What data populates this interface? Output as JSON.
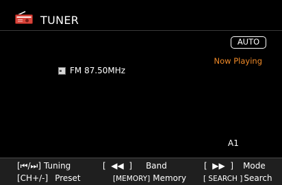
{
  "header": {
    "title": "TUNER",
    "icon": "radio-icon",
    "icon_color": "#d9443b"
  },
  "main": {
    "mode_badge": "AUTO",
    "now_playing": "Now Playing",
    "now_playing_color": "#f08a28",
    "band_icon": "fm-band-icon",
    "station": "FM 87.50MHz",
    "preset_number": "A1"
  },
  "footer": {
    "row1": [
      {
        "key": "[⏮/⏭]",
        "label": "Tuning"
      },
      {
        "key": "[  ◀◀  ]",
        "label": "Band"
      },
      {
        "key": "[  ▶▶  ]",
        "label": "Mode"
      }
    ],
    "row2": [
      {
        "key": "[CH+/-]",
        "label": "Preset"
      },
      {
        "key": "[MEMORY]",
        "label": "Memory"
      },
      {
        "key": "[ SEARCH ]",
        "label": "Search"
      }
    ]
  }
}
